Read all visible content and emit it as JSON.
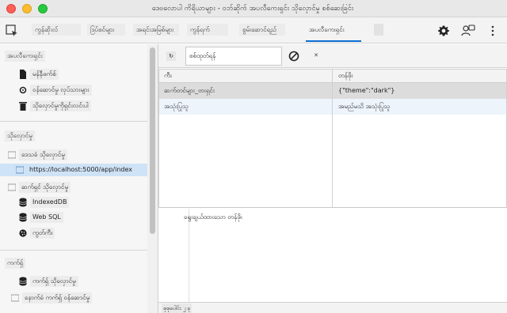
{
  "window": {
    "title": "ဒေဗလောပါ ကိရိယာများ - ဝဘ်ဆိုက် အပလီကေးရှင်း သိုလှောင်မှု စစ်ဆေးခြင်း"
  },
  "toolbar": {
    "tabs": [
      {
        "label": "ကွန်ဆိုးလ်"
      },
      {
        "label": "ဒြပ်စင်များ"
      },
      {
        "label": "အရင်းအမြစ်များ"
      },
      {
        "label": "ကွန်ရက်"
      },
      {
        "label": "စွမ်းဆောင်ရည်"
      },
      {
        "label": "အပလီကေးရှင်း"
      }
    ],
    "active_tab": "အပလီကေးရှင်း"
  },
  "sidebar": {
    "app_section_title": "အပလီကေးရှင်း",
    "app_items": [
      {
        "label": "မန်နီဖက်စ်",
        "icon": "file-icon"
      },
      {
        "label": "ဝန်ဆောင်မှု လုပ်သားများ",
        "icon": "gear-icon"
      },
      {
        "label": "သိုလှောင်မှုကိုရှင်းလင်းပါ",
        "icon": "trash-icon"
      }
    ],
    "storage_section_title": "သိုလှောင်မှု",
    "storage_items": [
      {
        "label": "ဒေသခံ သိုလှောင်မှု",
        "icon": "grid-icon"
      },
      {
        "label": "https://localhost:5000/app/index",
        "icon": "grid-icon",
        "selected": true
      },
      {
        "label": "ဆက်ရှင် သိုလှောင်မှု",
        "icon": "grid-icon"
      },
      {
        "label": "IndexedDB",
        "icon": "database-icon"
      },
      {
        "label": "Web SQL",
        "icon": "database-icon"
      },
      {
        "label": "ကွတ်ကီး",
        "icon": "cookie-icon"
      }
    ],
    "cache_section_title": "ကက်ရှ်",
    "cache_items": [
      {
        "label": "ကက်ရှ် သိုလှောင်မှု",
        "icon": "database-icon"
      },
      {
        "label": "နောက်ခံ ကက်ရှ် ဝန်ဆောင်မှု",
        "icon": "grid-icon"
      }
    ]
  },
  "filter": {
    "refresh_label": "↻",
    "value": "စစ်ထုတ်ရန်",
    "placeholder": "စစ်ထုတ်ရန်",
    "delete_label": "✕"
  },
  "table": {
    "columns": [
      "ကီး",
      "တန်ဖိုး"
    ],
    "rows": [
      {
        "key": "ဆက်တင်များ_ဗားရှင်း",
        "value": "{\"theme\":\"dark\"}"
      },
      {
        "key": "အသုံးပြုသူ",
        "value": "အမည်မသိ အသုံးပြုသူ"
      }
    ]
  },
  "preview": {
    "text": "ရွေးချယ်ထားသော တန်ဖိုး"
  },
  "status": {
    "text": "စုစုပေါင်း ၂ ခု"
  },
  "colors": {
    "accent": "#0a6ed1",
    "selected_row": "#dcdcdc",
    "sidebar_selected": "#cfe3f7"
  }
}
